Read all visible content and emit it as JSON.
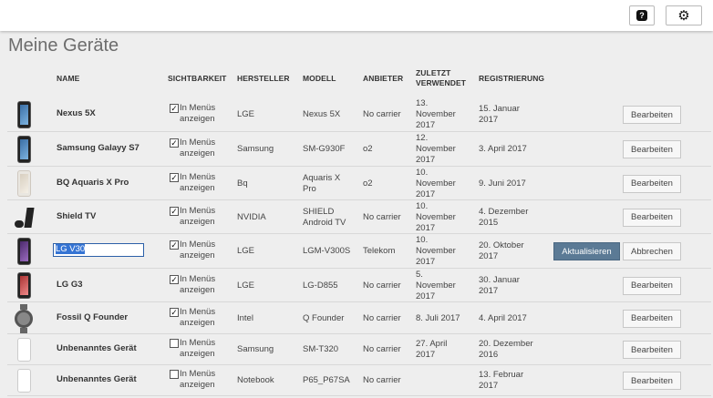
{
  "header": {
    "help_icon": "help-icon",
    "settings_icon": "gear-icon"
  },
  "page_title": "Meine Geräte",
  "columns": {
    "name": "NAME",
    "visibility": "SICHTBARKEIT",
    "manufacturer": "HERSTELLER",
    "model": "MODELL",
    "carrier": "ANBIETER",
    "last_used_line1": "ZULETZT",
    "last_used_line2": "VERWENDET",
    "registered": "REGISTRIERUNG"
  },
  "visibility_line1": "In Menüs",
  "visibility_line2": "anzeigen",
  "edit_label": "Bearbeiten",
  "update_label": "Aktualisieren",
  "cancel_label": "Abbrechen",
  "rows": [
    {
      "name": "Nexus 5X",
      "checked": true,
      "manufacturer": "LGE",
      "model_l1": "Nexus 5X",
      "model_l2": "",
      "carrier": "No carrier",
      "last_l1": "13.",
      "last_l2": "November",
      "last_l3": "2017",
      "reg_l1": "15. Januar",
      "reg_l2": "2017",
      "image": "phone"
    },
    {
      "name": "Samsung Galayy S7",
      "checked": true,
      "manufacturer": "Samsung",
      "model_l1": "SM-G930F",
      "model_l2": "",
      "carrier": "o2",
      "last_l1": "12.",
      "last_l2": "November",
      "last_l3": "2017",
      "reg_l1": "3. April 2017",
      "reg_l2": "",
      "image": "phone"
    },
    {
      "name": "BQ Aquaris X Pro",
      "checked": true,
      "manufacturer": "Bq",
      "model_l1": "Aquaris X",
      "model_l2": "Pro",
      "carrier": "o2",
      "last_l1": "10.",
      "last_l2": "November",
      "last_l3": "2017",
      "reg_l1": "9. Juni 2017",
      "reg_l2": "",
      "image": "phone-light"
    },
    {
      "name": "Shield TV",
      "checked": true,
      "manufacturer": "NVIDIA",
      "model_l1": "SHIELD",
      "model_l2": "Android TV",
      "carrier": "No carrier",
      "last_l1": "10.",
      "last_l2": "November",
      "last_l3": "2017",
      "reg_l1": "4. Dezember",
      "reg_l2": "2015",
      "image": "shield-tv"
    },
    {
      "name": "LG V30",
      "checked": true,
      "manufacturer": "LGE",
      "model_l1": "LGM-V300S",
      "model_l2": "",
      "carrier": "Telekom",
      "last_l1": "10.",
      "last_l2": "November",
      "last_l3": "2017",
      "reg_l1": "20. Oktober",
      "reg_l2": "2017",
      "image": "phone-purple",
      "editing": true
    },
    {
      "name": "LG G3",
      "checked": true,
      "manufacturer": "LGE",
      "model_l1": "LG-D855",
      "model_l2": "",
      "carrier": "No carrier",
      "last_l1": "5.",
      "last_l2": "November",
      "last_l3": "2017",
      "reg_l1": "30. Januar",
      "reg_l2": "2017",
      "image": "phone-pink"
    },
    {
      "name": "Fossil Q Founder",
      "checked": true,
      "manufacturer": "Intel",
      "model_l1": "Q Founder",
      "model_l2": "",
      "carrier": "No carrier",
      "last_l1": "8. Juli 2017",
      "last_l2": "",
      "last_l3": "",
      "reg_l1": "4. April 2017",
      "reg_l2": "",
      "image": "watch"
    },
    {
      "name": "Unbenanntes Gerät",
      "checked": false,
      "manufacturer": "Samsung",
      "model_l1": "SM-T320",
      "model_l2": "",
      "carrier": "No carrier",
      "last_l1": "27. April",
      "last_l2": "2017",
      "last_l3": "",
      "reg_l1": "20. Dezember",
      "reg_l2": "2016",
      "image": "blank"
    },
    {
      "name": "Unbenanntes Gerät",
      "checked": false,
      "manufacturer": "Notebook",
      "model_l1": "P65_P67SA",
      "model_l2": "",
      "carrier": "No carrier",
      "last_l1": "",
      "last_l2": "",
      "last_l3": "",
      "reg_l1": "13. Februar",
      "reg_l2": "2017",
      "image": "blank"
    }
  ]
}
